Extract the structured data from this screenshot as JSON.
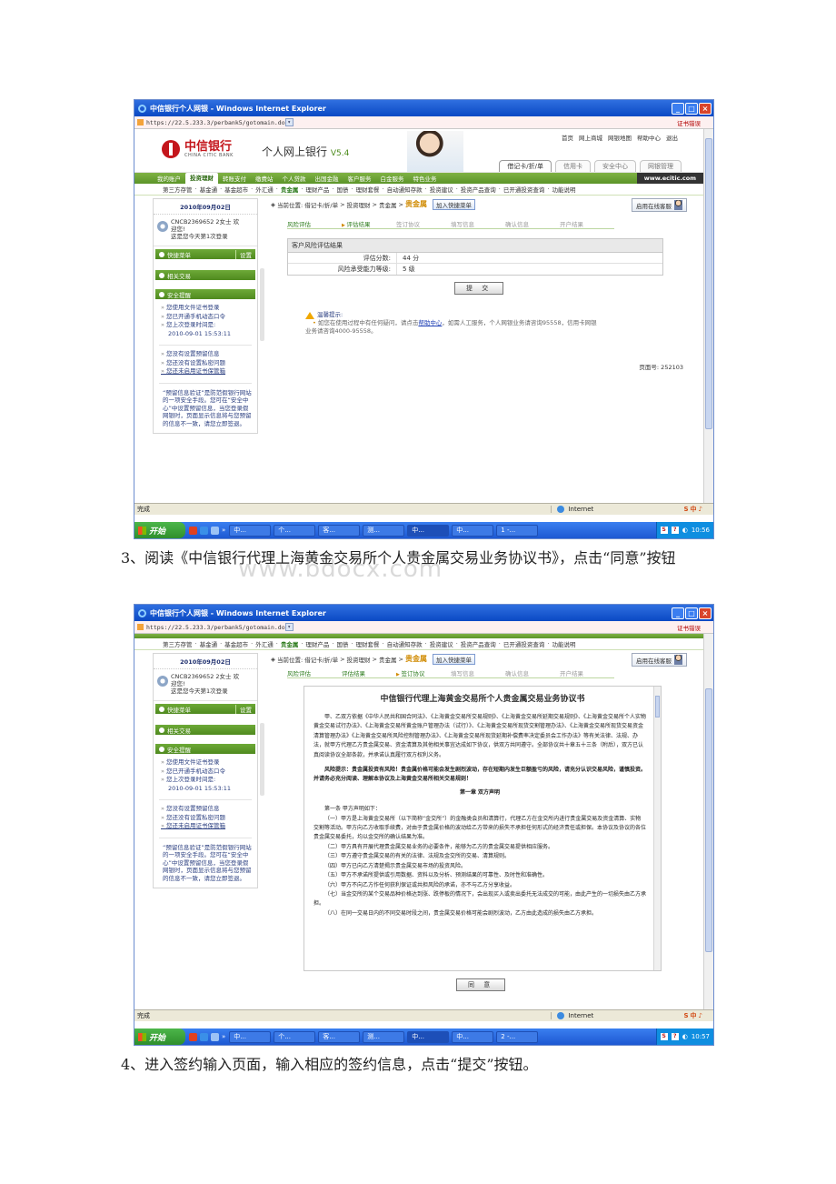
{
  "browser": {
    "title": "中信银行个人网银 - Windows Internet Explorer",
    "url": "https://22.5.233.3/perbank5/gotomain.do",
    "cert_error": "证书错误",
    "status_done": "完成",
    "zone": "Internet"
  },
  "taskbar": {
    "start": "开始",
    "more": "»",
    "tasks": [
      "中...",
      "个...",
      "客...",
      "测...",
      "中...",
      "中..."
    ],
    "task_word_1": "1 -...",
    "task_word_2": "2 -...",
    "clock_1": "10:56",
    "clock_2": "10:57"
  },
  "bank": {
    "logo_cn": "中信银行",
    "logo_en": "CHINA CITIC BANK",
    "product": "个人网上银行",
    "version": "V5.4",
    "toplinks": [
      "首页",
      "网上商城",
      "网银地图",
      "帮助中心",
      "退出"
    ],
    "card_tabs": [
      "借记卡/折/单",
      "信用卡",
      "安全中心",
      "网银管理"
    ],
    "nav1": [
      "我的账户",
      "投资理财",
      "转账支付",
      "缴费站",
      "个人贷款",
      "出国金融",
      "客户服务",
      "白金服务",
      "特色业务"
    ],
    "site": "www.ecitic.com",
    "nav2": [
      "第三方存管",
      "基金通",
      "基金超市",
      "外汇通",
      "贵金属",
      "理财产品",
      "国债",
      "理财套餐",
      "自动通知存款",
      "投资建议",
      "投资产品查询",
      "已开通投资查询",
      "功能说明"
    ]
  },
  "left": {
    "date": "2010年09月02日",
    "greeting_1": "CNCB2369652 2女士 欢",
    "greeting_2": "迎您!",
    "greeting_3": "这是您今天第1次登录",
    "quick_menu": "快捷菜单",
    "settings": "设置",
    "related": "相关交易",
    "security": "安全提醒",
    "tips1": [
      "您使用文件证书登录",
      "您已开通手机动态口令",
      "您上次登录时间是:"
    ],
    "last_login": "2010-09-01 15:53:11",
    "tips2": [
      "您没有设置预留信息",
      "您还没有设置私密问题",
      "您还未启用证书保管箱"
    ],
    "notice": "“预留信息验证”是防范假银行网站的一项安全手段。您可在“安全中心”中设置预留信息，当您登录假网银时，页面显示信息将与您预留的信息不一致，请您立即签退。"
  },
  "main": {
    "crumb_prefix": "当前位置:",
    "crumb": [
      "借记卡/折/单",
      "投资理财",
      "贵金属"
    ],
    "crumb_gold": "贵金属",
    "add_quick": "加入快捷菜单",
    "online": "启用在线客服",
    "steps": [
      "风险评估",
      "评估结果",
      "签订协议",
      "填写信息",
      "确认信息",
      "开户结果"
    ],
    "eval_header": "客户风险评估结果",
    "score_label": "评估分数:",
    "score_value": "44 分",
    "level_label": "风险承受能力等级:",
    "level_value": "5 级",
    "submit": "提 交",
    "warn_title": "温馨提示:",
    "warn_a": "如您在使用过程中有任何疑问，请点击",
    "warn_link": "帮助中心",
    "warn_b": "，如需人工服务，个人网银业务请咨询95558，信用卡网银",
    "warn_c": "业务请咨询4000-95558。",
    "page_no": "页面号: 252103"
  },
  "agreement": {
    "title": "中信银行代理上海黄金交易所个人贵金属交易业务协议书",
    "p1": "甲、乙双方依据《中华人民共和国合同法》、《上海黄金交易所交易规则》、《上海黄金交易所延期交易规则》、《上海黄金交易所个人实物黄金交易试行办法》、《上海黄金交易所黄金账户管理办法（试行）》、《上海黄金交易所现货交割管理办法》、《上海黄金交易所现货交易资金清算管理办法》《上海黄金交易所风险控制管理办法》、《上海黄金交易所现货延期补偿费率决定委员会工作办法》等有关法律、法规、办法，就甲方代理乙方贵金属交易、资金清算及其他相关事宜达成如下协议，供双方共同遵守。全部协议共十章五十三条（附后），双方已认真阅读协议全部条款，并承诺认真履行双方权利义务。",
    "risk": "风险提示：贵金属投资有风险！贵金属价格可能会发生剧烈波动，存在短期内发生巨额盈亏的风险，请充分认识交易风险，谨慎投资。并请务必充分阅读、理解本协议及上海黄金交易所相关交易规则！",
    "chapter": "第一章 双方声明",
    "art1": "第一条 甲方声明如下：",
    "items": [
      "（一）甲方是上海黄金交易所（以下简称“金交所”）的金融类会员和清算行，代理乙方在金交所内进行贵金属交易及资金清算、实物交割等活动。甲方向乙方收取手续费，对由于贵金属价格的波动给乙方带来的损失不承担任何形式的经济责任或担保。本协议及协议的各位贵金属交易委托，均以金交所的确认结果为准。",
      "（二）甲方具有开展代理贵金属交易业务的必要条件，能够为乙方的贵金属交易提供相应服务。",
      "（三）甲方遵守贵金属交易的有关的法律、法规及金交所的交易、清算规则。",
      "（四）甲方已向乙方清楚揭示贵金属交易市场的投资风险。",
      "（五）甲方不承诺所提供或引用数据、资料以及分析、预测结果的可靠性、及时性和准确性。",
      "（六）甲方不向乙方作任何获利保证或共担风险的承诺，亦不与乙方分享收益。",
      "（七）当金交所的某个交易品种价格达到涨、跌停板的情况下，会出现买入或卖出委托无法成交的可能，由此产生的一切损失由乙方承担。",
      "（八）在同一交易日内的不同交易时段之间，贵金属交易价格可能会剧烈波动，乙方由此造成的损失由乙方承担。"
    ],
    "agree_button": "同 意"
  },
  "captions": {
    "step3": "3、阅读《中信银行代理上海黄金交易所个人贵金属交易业务协议书》，点击“同意”按钮",
    "step4": "4、进入签约输入页面，输入相应的签约信息，点击“提交”按钮。"
  },
  "watermark": "www.bdocx.com",
  "colors": {
    "brand_red": "#c4161c",
    "nav_green": "#5b9429",
    "xp_blue": "#0a49c4",
    "gold": "#d08a00"
  }
}
